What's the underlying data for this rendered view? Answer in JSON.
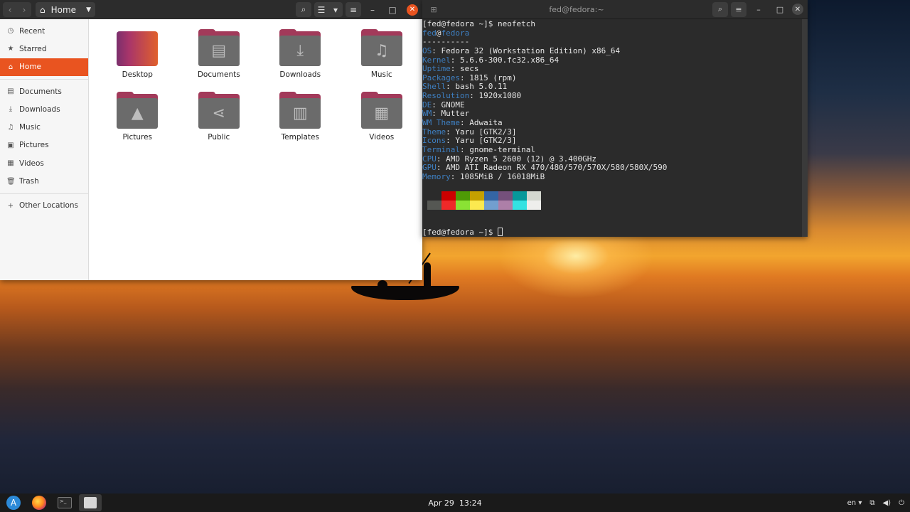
{
  "files": {
    "location": "Home",
    "sidebar": [
      {
        "label": "Recent",
        "icon": "clock-icon",
        "glyph": "◷"
      },
      {
        "label": "Starred",
        "icon": "star-icon",
        "glyph": "★"
      },
      {
        "label": "Home",
        "icon": "home-icon",
        "glyph": "⌂",
        "active": true
      },
      {
        "label": "Documents",
        "icon": "document-icon",
        "glyph": "▤"
      },
      {
        "label": "Downloads",
        "icon": "download-icon",
        "glyph": "⤓"
      },
      {
        "label": "Music",
        "icon": "music-icon",
        "glyph": "♫"
      },
      {
        "label": "Pictures",
        "icon": "picture-icon",
        "glyph": "▣"
      },
      {
        "label": "Videos",
        "icon": "video-icon",
        "glyph": "▦"
      },
      {
        "label": "Trash",
        "icon": "trash-icon",
        "glyph": "🗑"
      }
    ],
    "other_locations": {
      "label": "Other Locations",
      "glyph": "+"
    },
    "folders": [
      {
        "label": "Desktop",
        "glyph": ""
      },
      {
        "label": "Documents",
        "glyph": "▤"
      },
      {
        "label": "Downloads",
        "glyph": "⤓"
      },
      {
        "label": "Music",
        "glyph": "♫"
      },
      {
        "label": "Pictures",
        "glyph": "▲"
      },
      {
        "label": "Public",
        "glyph": "⋖"
      },
      {
        "label": "Templates",
        "glyph": "▥"
      },
      {
        "label": "Videos",
        "glyph": "▦"
      }
    ]
  },
  "terminal": {
    "title": "fed@fedora:~",
    "prompt1": "[fed@fedora ~]$ neofetch",
    "user": "fed",
    "host": "fedora",
    "separator": "----------",
    "info": [
      {
        "k": "OS",
        "v": ": Fedora 32 (Workstation Edition) x86_64"
      },
      {
        "k": "Kernel",
        "v": ": 5.6.6-300.fc32.x86_64"
      },
      {
        "k": "Uptime",
        "v": ": secs"
      },
      {
        "k": "Packages",
        "v": ": 1815 (rpm)"
      },
      {
        "k": "Shell",
        "v": ": bash 5.0.11"
      },
      {
        "k": "Resolution",
        "v": ": 1920x1080"
      },
      {
        "k": "DE",
        "v": ": GNOME"
      },
      {
        "k": "WM",
        "v": ": Mutter"
      },
      {
        "k": "WM Theme",
        "v": ": Adwaita"
      },
      {
        "k": "Theme",
        "v": ": Yaru [GTK2/3]"
      },
      {
        "k": "Icons",
        "v": ": Yaru [GTK2/3]"
      },
      {
        "k": "Terminal",
        "v": ": gnome-terminal"
      },
      {
        "k": "CPU",
        "v": ": AMD Ryzen 5 2600 (12) @ 3.400GHz"
      },
      {
        "k": "GPU",
        "v": ": AMD ATI Radeon RX 470/480/570/570X/580/580X/590"
      },
      {
        "k": "Memory",
        "v": ": 1085MiB / 16018MiB"
      }
    ],
    "palette_top": [
      "#2b2b2b",
      "#cc0000",
      "#4e9a06",
      "#c4a000",
      "#3465a4",
      "#75507b",
      "#06989a",
      "#d3d7cf"
    ],
    "palette_bottom": [
      "#555753",
      "#ef2929",
      "#8ae234",
      "#fce94f",
      "#729fcf",
      "#ad7fa8",
      "#34e2e2",
      "#eeeeec"
    ],
    "prompt2": "[fed@fedora ~]$ "
  },
  "taskbar": {
    "date": "Apr 29",
    "time": "13:24",
    "lang": "en"
  }
}
